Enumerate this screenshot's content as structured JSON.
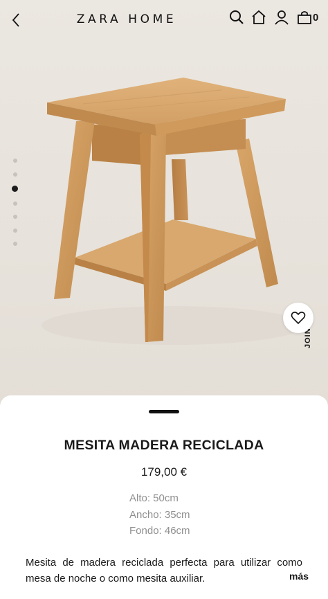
{
  "header": {
    "brand": "ZARA HOME",
    "cart_count": "0",
    "icons": [
      "back-icon",
      "search-icon",
      "home-icon",
      "user-icon",
      "bag-icon"
    ]
  },
  "gallery": {
    "image": "wooden-nightstand-photo",
    "dot_count": 7,
    "active_index": 2,
    "side_tab": "JOIN"
  },
  "product": {
    "name": "MESITA MADERA RECICLADA",
    "price": "179,00 €",
    "dimensions": [
      "Alto: 50cm",
      "Ancho: 35cm",
      "Fondo: 46cm"
    ],
    "description": "Mesita de madera reciclada perfecta para utilizar como mesa de noche o como mesita auxiliar.",
    "more_label": "más"
  }
}
